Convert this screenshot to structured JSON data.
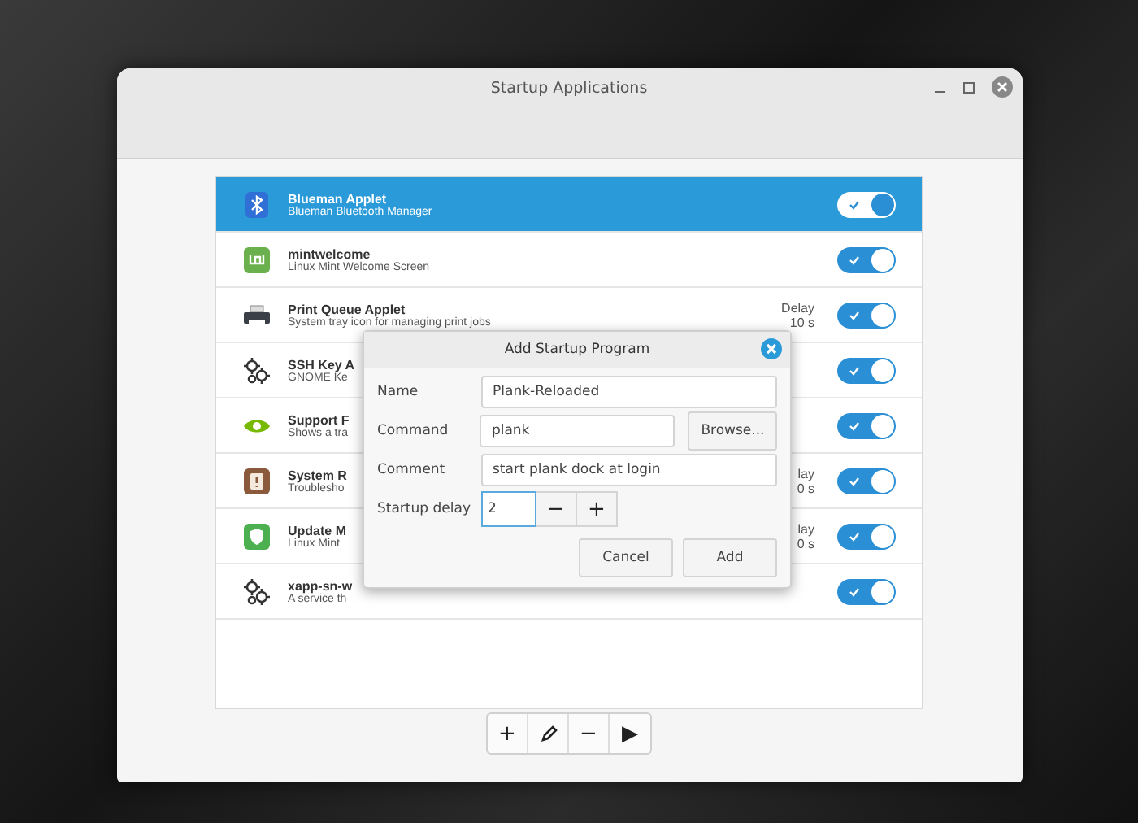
{
  "window": {
    "title": "Startup Applications"
  },
  "apps": [
    {
      "name": "Blueman Applet",
      "comment": "Blueman Bluetooth Manager",
      "kind": "bluetooth",
      "selected": true,
      "enabled": true
    },
    {
      "name": "mintwelcome",
      "comment": "Linux Mint Welcome Screen",
      "kind": "mint",
      "selected": false,
      "enabled": true
    },
    {
      "name": "Print Queue Applet",
      "comment": "System tray icon for managing print jobs",
      "kind": "printer",
      "delay_label": "Delay",
      "delay": "10 s",
      "selected": false,
      "enabled": true
    },
    {
      "name": "SSH Key A",
      "comment": "GNOME Ke",
      "kind": "gears",
      "selected": false,
      "enabled": true
    },
    {
      "name": "Support F",
      "comment": "Shows a tra",
      "kind": "eye",
      "selected": false,
      "enabled": true
    },
    {
      "name": "System R",
      "comment": "Troublesho",
      "kind": "alert",
      "delay_label": "lay",
      "delay": "0 s",
      "selected": false,
      "enabled": true
    },
    {
      "name": "Update M",
      "comment": "Linux Mint",
      "kind": "shield",
      "delay_label": "lay",
      "delay": "0 s",
      "selected": false,
      "enabled": true
    },
    {
      "name": "xapp-sn-w",
      "comment": "A service th",
      "kind": "gears",
      "selected": false,
      "enabled": true
    }
  ],
  "toolbar": [
    "+",
    "−",
    "▶"
  ],
  "dialog": {
    "title": "Add Startup Program",
    "fields": [
      {
        "label": "Name",
        "value": "Plank-Reloaded"
      },
      {
        "label": "Command",
        "value": "plank",
        "button": "Browse..."
      },
      {
        "label": "Comment",
        "value": "start plank dock at login"
      }
    ],
    "delay": {
      "label": "Startup delay",
      "value": "2",
      "minus": "−",
      "plus": "+"
    },
    "buttons": [
      "Cancel",
      "Add"
    ]
  }
}
